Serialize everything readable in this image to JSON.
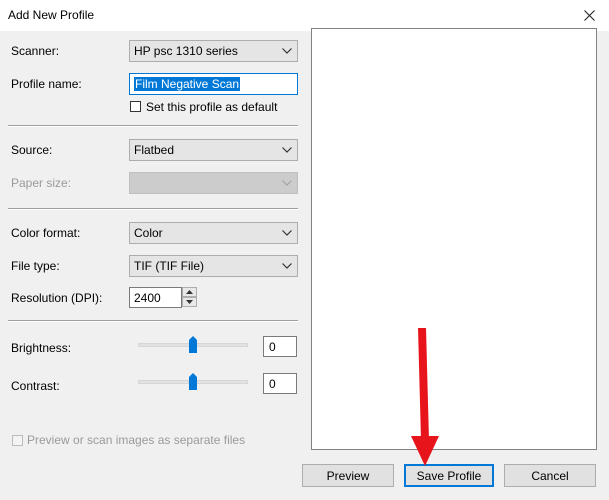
{
  "window": {
    "title": "Add New Profile"
  },
  "form": {
    "scanner": {
      "label": "Scanner:",
      "value": "HP psc 1310 series"
    },
    "profile_name": {
      "label": "Profile name:",
      "value": "Film Negative Scan"
    },
    "default_checkbox": {
      "label": "Set this profile as default",
      "checked": false
    },
    "source": {
      "label": "Source:",
      "value": "Flatbed"
    },
    "paper_size": {
      "label": "Paper size:",
      "value": "",
      "disabled": true
    },
    "color_format": {
      "label": "Color format:",
      "value": "Color"
    },
    "file_type": {
      "label": "File type:",
      "value": "TIF (TIF File)"
    },
    "resolution": {
      "label": "Resolution (DPI):",
      "value": "2400"
    },
    "brightness": {
      "label": "Brightness:",
      "value": "0",
      "level": 0.5
    },
    "contrast": {
      "label": "Contrast:",
      "value": "0",
      "level": 0.5
    },
    "separate_files": {
      "label": "Preview or scan images as separate files",
      "disabled": true,
      "checked": false
    }
  },
  "buttons": {
    "preview": "Preview",
    "save_profile": "Save Profile",
    "cancel": "Cancel"
  },
  "icons": {
    "close": "close-icon",
    "dropdown": "chevron-down-icon",
    "annotation": "red-arrow-icon"
  },
  "colors": {
    "accent": "#0078d7",
    "annotation_arrow": "#e8141b",
    "dialog_bg": "#f0f0f0"
  }
}
